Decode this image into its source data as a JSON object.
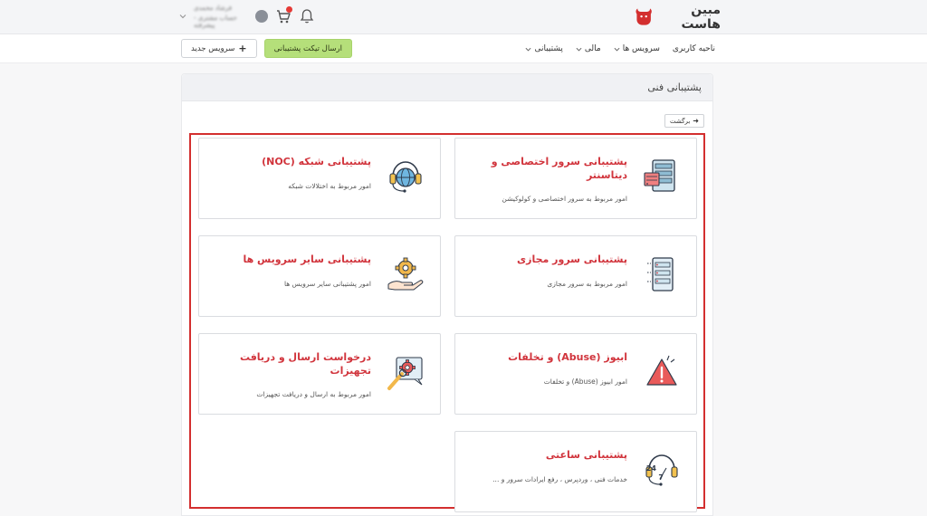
{
  "header": {
    "logo_text": "مبین هاست",
    "user_name": "فرشاد محمدی",
    "user_subtitle": "حساب مشتری - پیشرفته",
    "cart_badge": true
  },
  "nav": {
    "items": [
      {
        "label": "ناحیه کاربری",
        "has_dropdown": false
      },
      {
        "label": "سرویس ها",
        "has_dropdown": true
      },
      {
        "label": "مالی",
        "has_dropdown": true
      },
      {
        "label": "پشتیبانی",
        "has_dropdown": true
      }
    ],
    "new_service_label": "سرویس جدید",
    "send_ticket_label": "ارسال تیکت پشتیبانی"
  },
  "panel": {
    "title": "پشتیبانی فنی",
    "back_label": "برگشت"
  },
  "cards": [
    {
      "title": "پشتیبانی سرور اختصاصی و دیتاسنتر",
      "desc": "امور مربوط به سرور اختصاصی و کولوکیشن"
    },
    {
      "title": "پشتیبانی شبکه (NOC)",
      "desc": "امور مربوط به اختلالات شبکه"
    },
    {
      "title": "پشتیبانی سرور مجازی",
      "desc": "امور مربوط به سرور مجازی"
    },
    {
      "title": "پشتیبانی سایر سرویس ها",
      "desc": "امور پشتیبانی سایر سرویس ها"
    },
    {
      "title": "ابیوز (Abuse) و تخلفات",
      "desc": "امور ابیوز (Abuse) و تخلفات"
    },
    {
      "title": "درخواست ارسال و دریافت تجهیزات",
      "desc": "امور مربوط به ارسال و دریافت تجهیزات"
    },
    {
      "title": "پشتیبانی ساعتی",
      "desc": "خدمات فنی ، وردپرس ، رفع ایرادات سرور و ..."
    }
  ],
  "colors": {
    "accent_red": "#d1343c",
    "ticket_green": "#b5df7a",
    "highlight": "#d32f2f"
  }
}
